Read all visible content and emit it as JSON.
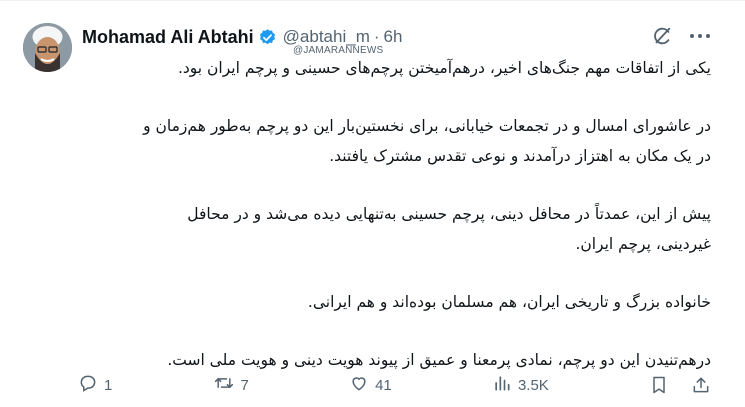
{
  "author": {
    "name": "Mohamad Ali Abtahi",
    "handle": "@abtahi_m",
    "separator": "·",
    "time": "6h"
  },
  "watermark": "@JAMARANNEWS",
  "tweet": {
    "paragraphs": [
      [
        "یکی از اتفاقات مهم جنگ‌های اخیر، درهم‌آمیختن پرچم‌های حسینی و پرچم ایران بود."
      ],
      [
        "در عاشورای امسال و در تجمعات خیابانی، برای نخستین‌بار این دو پرچم به‌طور هم‌زمان و",
        "در یک مکان به اهتزاز درآمدند و نوعی تقدس مشترک یافتند."
      ],
      [
        "پیش از این، عمدتاً در محافل دینی، پرچم حسینی به‌تنهایی دیده می‌شد و در محافل",
        "غیردینی، پرچم ایران."
      ],
      [
        "خانواده بزرگ و تاریخی ایران، هم مسلمان بوده‌اند و هم ایرانی."
      ],
      [
        "درهم‌تنیدن این دو پرچم، نمادی پرمعنا و عمیق از پیوند هویت دینی و هویت ملی است."
      ]
    ]
  },
  "metrics": {
    "replies": "1",
    "reposts": "7",
    "likes": "41",
    "views": "3.5K"
  },
  "icons": {
    "verified": "verified-badge-icon",
    "grok": "grok-icon",
    "more": "more-icon",
    "reply": "reply-icon",
    "repost": "repost-icon",
    "like": "like-icon",
    "views": "views-icon",
    "bookmark": "bookmark-icon",
    "share": "share-icon"
  },
  "colors": {
    "text": "#0f1419",
    "muted": "#536471",
    "verified": "#1d9bf0"
  }
}
